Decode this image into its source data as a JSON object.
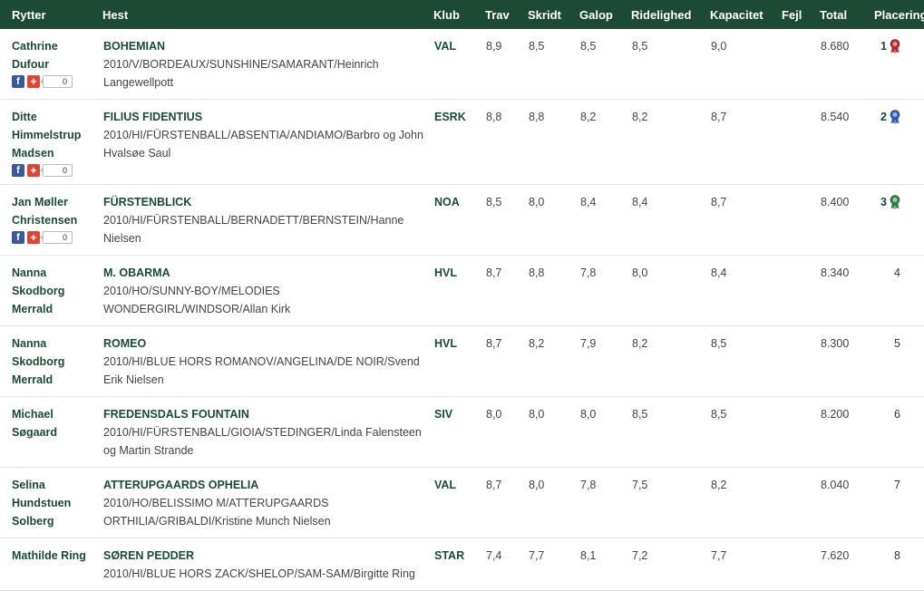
{
  "headers": {
    "rider": "Rytter",
    "horse": "Hest",
    "club": "Klub",
    "trav": "Trav",
    "skridt": "Skridt",
    "galop": "Galop",
    "ridelighed": "Ridelighed",
    "kapacitet": "Kapacitet",
    "fejl": "Fejl",
    "total": "Total",
    "placering": "Placering"
  },
  "share": {
    "facebook_icon": "f",
    "gplus_icon": "+",
    "count": "0"
  },
  "rows": [
    {
      "rider": "Cathrine Dufour",
      "horse": "BOHEMIAN",
      "info": "2010/V/BORDEAUX/SUNSHINE/SAMARANT/Heinrich Langewellpott",
      "club": "VAL",
      "trav": "8,9",
      "skridt": "8,5",
      "galop": "8,5",
      "ridelighed": "8,5",
      "kapacitet": "9,0",
      "fejl": "",
      "total": "8.680",
      "place": "1",
      "rosette": "#c0262d"
    },
    {
      "rider": "Ditte Himmelstrup Madsen",
      "horse": "FILIUS FIDENTIUS",
      "info": "2010/HI/FÜRSTENBALL/ABSENTIA/ANDIAMO/Barbro og John Hvalsøe Saul",
      "club": "ESRK",
      "trav": "8,8",
      "skridt": "8,8",
      "galop": "8,2",
      "ridelighed": "8,2",
      "kapacitet": "8,7",
      "fejl": "",
      "total": "8.540",
      "place": "2",
      "rosette": "#2a62b8"
    },
    {
      "rider": "Jan Møller Christensen",
      "horse": "FÜRSTENBLICK",
      "info": "2010/HI/FÜRSTENBALL/BERNADETT/BERNSTEIN/Hanne Nielsen",
      "club": "NOA",
      "trav": "8,5",
      "skridt": "8,0",
      "galop": "8,4",
      "ridelighed": "8,4",
      "kapacitet": "8,7",
      "fejl": "",
      "total": "8.400",
      "place": "3",
      "rosette": "#2e8a4a"
    },
    {
      "rider": "Nanna Skodborg Merrald",
      "horse": "M. OBARMA",
      "info": "2010/HO/SUNNY-BOY/MELODIES WONDERGIRL/WINDSOR/Allan Kirk",
      "club": "HVL",
      "trav": "8,7",
      "skridt": "8,8",
      "galop": "7,8",
      "ridelighed": "8,0",
      "kapacitet": "8,4",
      "fejl": "",
      "total": "8.340",
      "place": "4",
      "rosette": ""
    },
    {
      "rider": "Nanna Skodborg Merrald",
      "horse": "ROMEO",
      "info": "2010/HI/BLUE HORS ROMANOV/ANGELINA/DE NOIR/Svend Erik Nielsen",
      "club": "HVL",
      "trav": "8,7",
      "skridt": "8,2",
      "galop": "7,9",
      "ridelighed": "8,2",
      "kapacitet": "8,5",
      "fejl": "",
      "total": "8.300",
      "place": "5",
      "rosette": ""
    },
    {
      "rider": "Michael Søgaard",
      "horse": "FREDENSDALS FOUNTAIN",
      "info": "2010/HI/FÜRSTENBALL/GIOIA/STEDINGER/Linda Falensteen og Martin Strande",
      "club": "SIV",
      "trav": "8,0",
      "skridt": "8,0",
      "galop": "8,0",
      "ridelighed": "8,5",
      "kapacitet": "8,5",
      "fejl": "",
      "total": "8.200",
      "place": "6",
      "rosette": ""
    },
    {
      "rider": "Selina Hundstuen Solberg",
      "horse": "ATTERUPGAARDS OPHELIA",
      "info": "2010/HO/BELISSIMO M/ATTERUPGAARDS ORTHILIA/GRIBALDI/Kristine Munch Nielsen",
      "club": "VAL",
      "trav": "8,7",
      "skridt": "8,0",
      "galop": "7,8",
      "ridelighed": "7,5",
      "kapacitet": "8,2",
      "fejl": "",
      "total": "8.040",
      "place": "7",
      "rosette": ""
    },
    {
      "rider": "Mathilde Ring",
      "horse": "SØREN PEDDER",
      "info": "2010/HI/BLUE HORS ZACK/SHELOP/SAM-SAM/Birgitte Ring",
      "club": "STAR",
      "trav": "7,4",
      "skridt": "7,7",
      "galop": "8,1",
      "ridelighed": "7,2",
      "kapacitet": "7,7",
      "fejl": "",
      "total": "7.620",
      "place": "8",
      "rosette": ""
    }
  ]
}
